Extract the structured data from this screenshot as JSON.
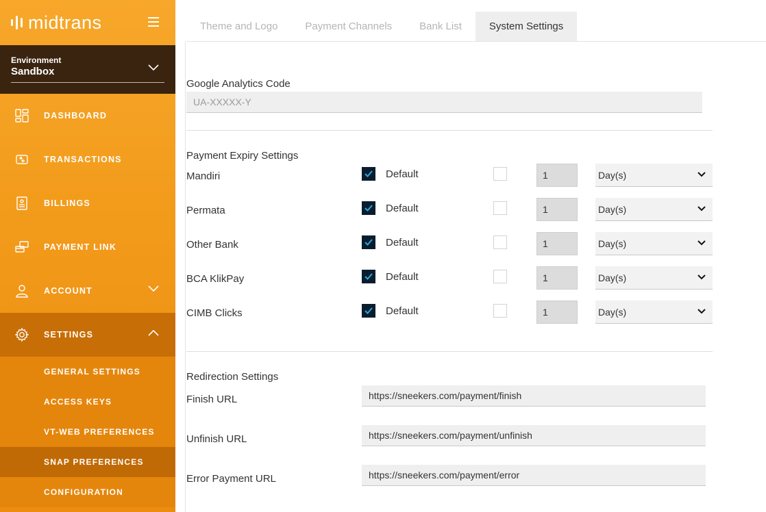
{
  "brand": {
    "name": "midtrans"
  },
  "environment": {
    "label": "Environment",
    "value": "Sandbox"
  },
  "nav": {
    "dashboard": "DASHBOARD",
    "transactions": "TRANSACTIONS",
    "billings": "BILLINGS",
    "payment_link": "PAYMENT LINK",
    "account": "ACCOUNT",
    "settings": "SETTINGS",
    "sub": {
      "general": "GENERAL SETTINGS",
      "access_keys": "ACCESS KEYS",
      "vtweb": "VT-WEB PREFERENCES",
      "snap": "SNAP PREFERENCES",
      "configuration": "CONFIGURATION"
    }
  },
  "tabs": [
    "Theme and Logo",
    "Payment Channels",
    "Bank List",
    "System Settings"
  ],
  "analytics": {
    "title": "Google Analytics Code",
    "placeholder": "UA-XXXXX-Y"
  },
  "expiry": {
    "title": "Payment Expiry Settings",
    "default_label": "Default",
    "rows": [
      {
        "bank": "Mandiri",
        "default_checked": true,
        "value": "1",
        "unit": "Day(s)"
      },
      {
        "bank": "Permata",
        "default_checked": true,
        "value": "1",
        "unit": "Day(s)"
      },
      {
        "bank": "Other Bank",
        "default_checked": true,
        "value": "1",
        "unit": "Day(s)"
      },
      {
        "bank": "BCA KlikPay",
        "default_checked": true,
        "value": "1",
        "unit": "Day(s)"
      },
      {
        "bank": "CIMB Clicks",
        "default_checked": true,
        "value": "1",
        "unit": "Day(s)"
      }
    ]
  },
  "redirection": {
    "title": "Redirection Settings",
    "finish": {
      "label": "Finish URL",
      "value": "https://sneekers.com/payment/finish"
    },
    "unfinish": {
      "label": "Unfinish URL",
      "value": "https://sneekers.com/payment/unfinish"
    },
    "error": {
      "label": "Error Payment URL",
      "value": "https://sneekers.com/payment/error"
    }
  },
  "colors": {
    "accent": "#f29a1a",
    "sidebar_active": "#c86e06",
    "env_bg": "#3a2410",
    "checkbox_on": "#0a1d2e"
  }
}
